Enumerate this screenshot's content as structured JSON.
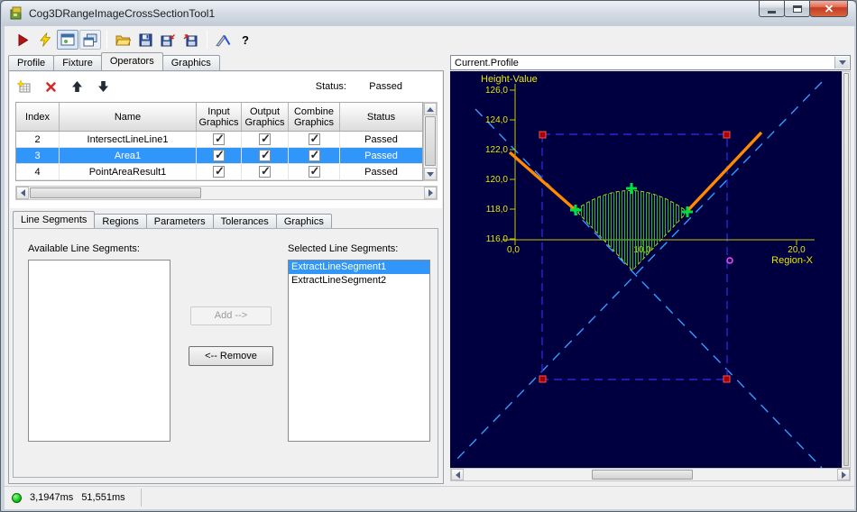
{
  "window": {
    "title": "Cog3DRangeImageCrossSectionTool1"
  },
  "toolbar": {
    "icons": [
      "run",
      "live-run",
      "show-last-run-record",
      "float-display",
      "open",
      "save",
      "save-image",
      "import",
      "measure",
      "help"
    ]
  },
  "tabs": {
    "items": [
      "Profile",
      "Fixture",
      "Operators",
      "Graphics"
    ],
    "active": "Operators"
  },
  "operators": {
    "toolbar": {
      "icons": [
        "add-operator",
        "delete-operator",
        "move-up",
        "move-down"
      ],
      "status_label": "Status:",
      "status_value": "Passed"
    },
    "table": {
      "columns": [
        "Index",
        "Name",
        "Input Graphics",
        "Output Graphics",
        "Combine Graphics",
        "Status"
      ],
      "rows": [
        {
          "index": "2",
          "name": "IntersectLineLine1",
          "input_graphics": true,
          "output_graphics": true,
          "combine_graphics": true,
          "status": "Passed",
          "selected": false
        },
        {
          "index": "3",
          "name": "Area1",
          "input_graphics": true,
          "output_graphics": true,
          "combine_graphics": true,
          "status": "Passed",
          "selected": true
        },
        {
          "index": "4",
          "name": "PointAreaResult1",
          "input_graphics": true,
          "output_graphics": true,
          "combine_graphics": true,
          "status": "Passed",
          "selected": false
        }
      ]
    },
    "subtabs": {
      "items": [
        "Line Segments",
        "Regions",
        "Parameters",
        "Tolerances",
        "Graphics"
      ],
      "active": "Line Segments"
    },
    "line_segments": {
      "available_label": "Available Line Segments:",
      "selected_label": "Selected Line Segments:",
      "available_items": [],
      "selected_items": [
        "ExtractLineSegment1",
        "ExtractLineSegment2"
      ],
      "highlighted_item": "ExtractLineSegment1",
      "add_label": "Add -->",
      "remove_label": "<-- Remove"
    }
  },
  "profile_display": {
    "selector_value": "Current.Profile",
    "chart": {
      "type": "line",
      "y_axis_title": "Height-Value",
      "x_axis_title": "Region-X",
      "y_ticks": [
        "126,0",
        "124,0",
        "122,0",
        "120,0",
        "118,0",
        "116,0"
      ],
      "x_ticks": [
        "0,0",
        "10,0",
        "20,0"
      ],
      "y_range": [
        116.0,
        126.0
      ],
      "x_range": [
        0.0,
        20.0
      ]
    }
  },
  "status_bar": {
    "process_time": "3,1947ms",
    "total_time": "51,551ms"
  },
  "colors": {
    "selection_blue": "#3096fa",
    "graph_background": "#000040",
    "axis_yellow": "#e6e600",
    "profile_orange": "#ff8a00",
    "region_green": "#22bb22",
    "crosshair_cyan": "#2f9fff",
    "handle_red": "#b40000",
    "rect_blue": "#2828cc",
    "marker_magenta": "#ff44ff"
  }
}
